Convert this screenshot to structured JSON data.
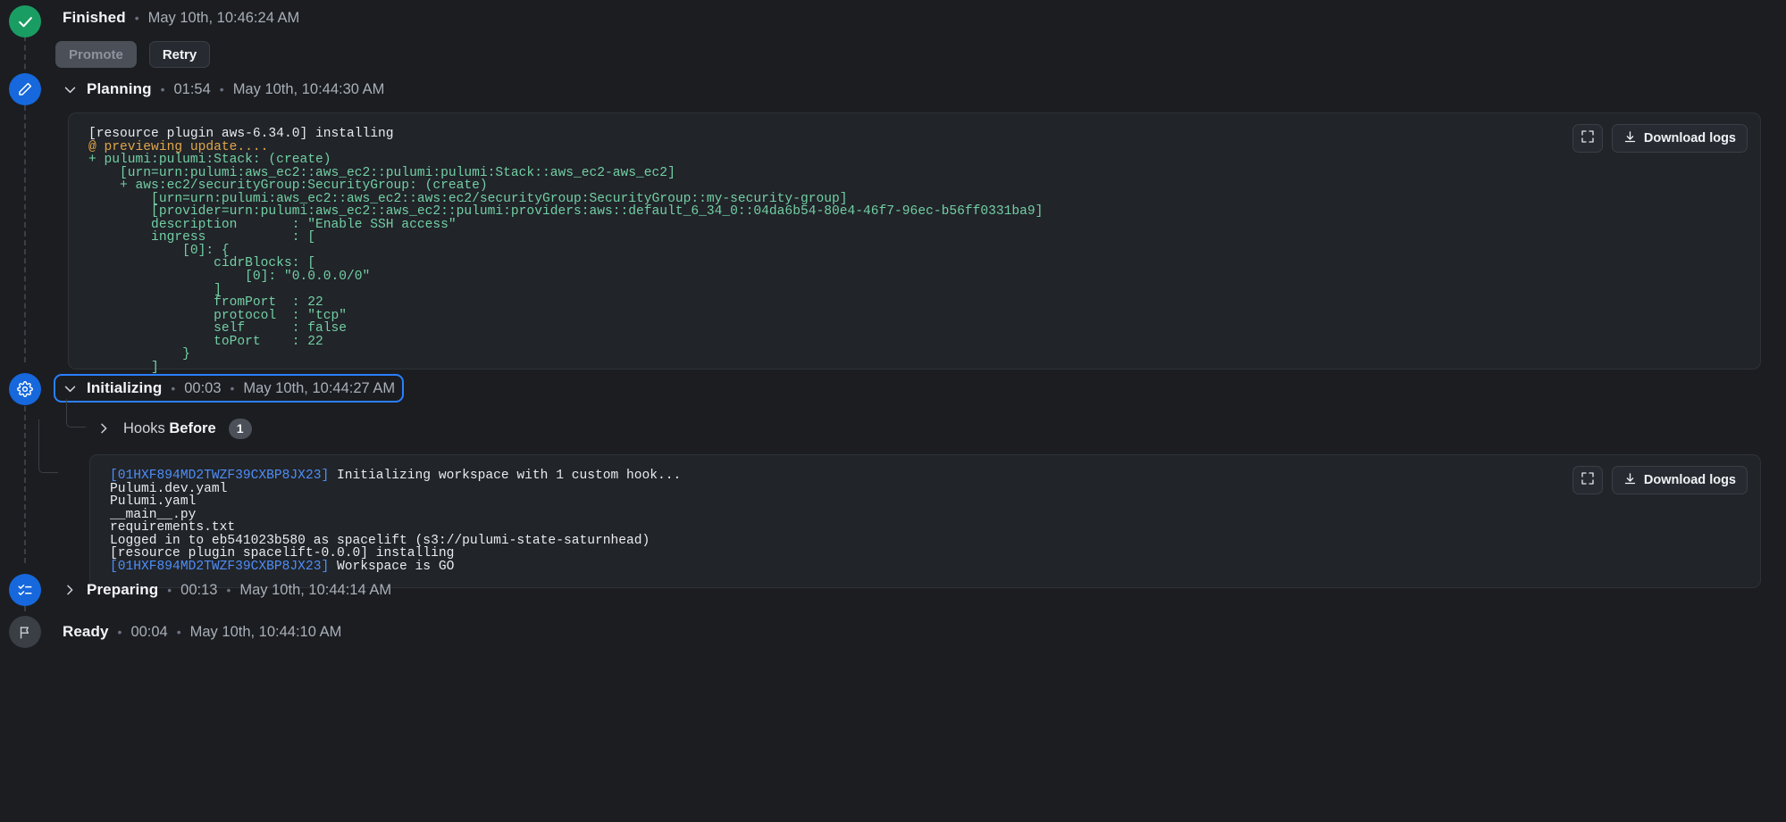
{
  "steps": [
    {
      "id": "finished",
      "title": "Finished",
      "timestamp": "May 10th, 10:46:24 AM",
      "icon": "check-circle-icon",
      "separator": "•"
    },
    {
      "id": "planning",
      "title": "Planning",
      "duration": "01:54",
      "timestamp": "May 10th, 10:44:30 AM",
      "icon": "pencil-icon",
      "separator": "•"
    },
    {
      "id": "initializing",
      "title": "Initializing",
      "duration": "00:03",
      "timestamp": "May 10th, 10:44:27 AM",
      "icon": "gear-icon",
      "separator": "•"
    },
    {
      "id": "preparing",
      "title": "Preparing",
      "duration": "00:13",
      "timestamp": "May 10th, 10:44:14 AM",
      "icon": "checklist-icon",
      "separator": "•"
    },
    {
      "id": "ready",
      "title": "Ready",
      "duration": "00:04",
      "timestamp": "May 10th, 10:44:10 AM",
      "icon": "flag-icon",
      "separator": "•"
    }
  ],
  "actions": {
    "promote_label": "Promote",
    "retry_label": "Retry",
    "download_logs_label": "Download logs",
    "expand_icon": "expand-icon",
    "download_icon": "download-icon"
  },
  "hooks": {
    "label_prefix": "Hooks",
    "label_strong": "Before",
    "count": "1"
  },
  "planning_log": [
    {
      "text": "[resource plugin aws-6.34.0] installing",
      "color": "white"
    },
    {
      "text": "@ previewing update....",
      "color": "amber"
    },
    {
      "text": "+ pulumi:pulumi:Stack: (create)",
      "color": "green"
    },
    {
      "text": "    [urn=urn:pulumi:aws_ec2::aws_ec2::pulumi:pulumi:Stack::aws_ec2-aws_ec2]",
      "color": "green"
    },
    {
      "text": "    + aws:ec2/securityGroup:SecurityGroup: (create)",
      "color": "green"
    },
    {
      "text": "        [urn=urn:pulumi:aws_ec2::aws_ec2::aws:ec2/securityGroup:SecurityGroup::my-security-group]",
      "color": "green"
    },
    {
      "text": "        [provider=urn:pulumi:aws_ec2::aws_ec2::pulumi:providers:aws::default_6_34_0::04da6b54-80e4-46f7-96ec-b56ff0331ba9]",
      "color": "green"
    },
    {
      "text": "        description       : \"Enable SSH access\"",
      "color": "green"
    },
    {
      "text": "        ingress           : [",
      "color": "green"
    },
    {
      "text": "            [0]: {",
      "color": "green"
    },
    {
      "text": "                cidrBlocks: [",
      "color": "green"
    },
    {
      "text": "                    [0]: \"0.0.0.0/0\"",
      "color": "green"
    },
    {
      "text": "                ]",
      "color": "green"
    },
    {
      "text": "                fromPort  : 22",
      "color": "green"
    },
    {
      "text": "                protocol  : \"tcp\"",
      "color": "green"
    },
    {
      "text": "                self      : false",
      "color": "green"
    },
    {
      "text": "                toPort    : 22",
      "color": "green"
    },
    {
      "text": "            }",
      "color": "green"
    },
    {
      "text": "        ]",
      "color": "green"
    }
  ],
  "initializing_log": [
    {
      "prefix": "[01HXF894MD2TWZF39CXBP8JX23]",
      "text": " Initializing workspace with 1 custom hook...",
      "color": "white"
    },
    {
      "text": "Pulumi.dev.yaml",
      "color": "white"
    },
    {
      "text": "Pulumi.yaml",
      "color": "white"
    },
    {
      "text": "__main__.py",
      "color": "white"
    },
    {
      "text": "requirements.txt",
      "color": "white"
    },
    {
      "text": "Logged in to eb541023b580 as spacelift (s3://pulumi-state-saturnhead)",
      "color": "white"
    },
    {
      "text": "[resource plugin spacelift-0.0.0] installing",
      "color": "white"
    },
    {
      "prefix": "[01HXF894MD2TWZF39CXBP8JX23]",
      "text": " Workspace is GO",
      "color": "white"
    }
  ],
  "colors": {
    "background": "#1b1d21",
    "panel": "#212429",
    "success": "#1a9d62",
    "accent": "#1668dc",
    "focus_ring": "#2b7fff",
    "log_amber": "#e0a64a",
    "log_green": "#72cfa4",
    "log_blue": "#4d8ef7"
  }
}
